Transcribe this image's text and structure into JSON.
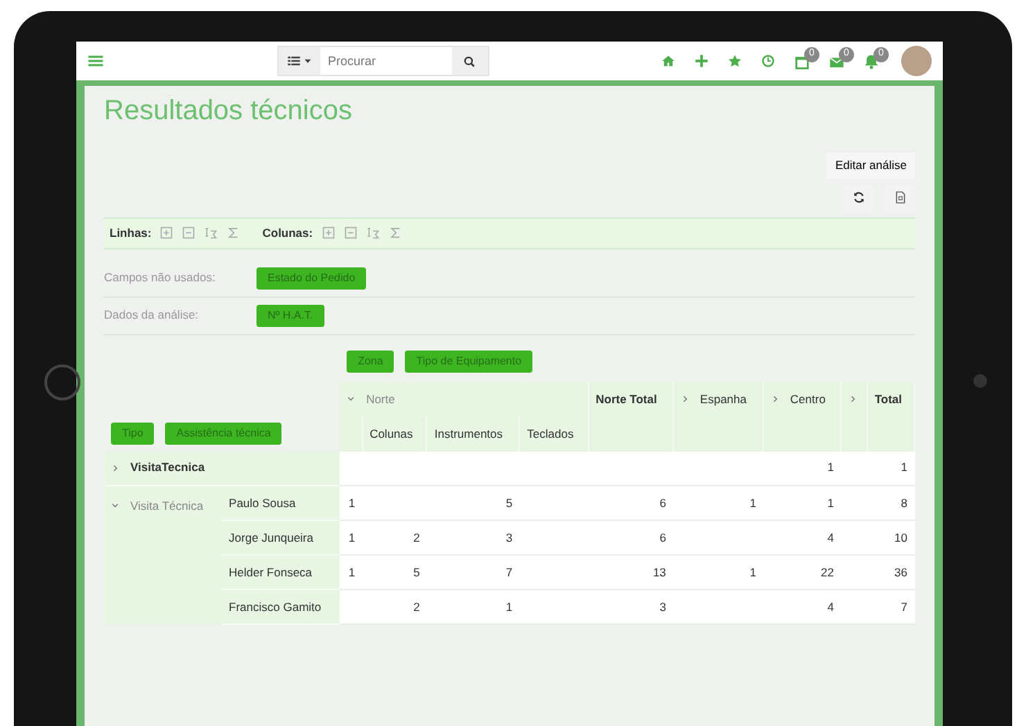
{
  "navbar": {
    "search": {
      "placeholder": "Procurar"
    },
    "notifications": [
      {
        "badge": "0"
      },
      {
        "badge": "0"
      },
      {
        "badge": "0"
      }
    ]
  },
  "page": {
    "title": "Resultados técnicos",
    "edit_button": "Editar análise"
  },
  "toolbar": [
    {
      "label": "Linhas:"
    },
    {
      "label": "Colunas:"
    }
  ],
  "fields": [
    {
      "label": "Campos não usados:",
      "chips": [
        "Estado do Pedido"
      ]
    },
    {
      "label": "Dados da análise:",
      "chips": [
        "Nº H.A.T."
      ]
    }
  ],
  "column_chips": [
    "Zona",
    "Tipo de Equipamento"
  ],
  "row_chips": [
    "Tipo",
    "Assistência técnica"
  ],
  "pivot": {
    "columns": [
      {
        "kind": "group",
        "label": "Norte",
        "expanded": true,
        "children": [
          {
            "kind": "blank"
          },
          {
            "label": "Colunas"
          },
          {
            "label": "Instrumentos"
          },
          {
            "label": "Teclados"
          }
        ]
      },
      {
        "kind": "total",
        "label": "Norte Total"
      },
      {
        "kind": "group",
        "label": "Espanha",
        "expanded": false
      },
      {
        "kind": "group",
        "label": "Centro",
        "expanded": false
      },
      {
        "kind": "group",
        "expanded": false
      },
      {
        "kind": "total",
        "label": "Total"
      }
    ],
    "rows": [
      {
        "label": "VisitaTecnica",
        "expanded": false,
        "values": {
          "col_7": "1",
          "col_9": "1"
        }
      },
      {
        "label": "Visita Técnica",
        "expanded": true,
        "children": [
          {
            "label": "Paulo Sousa",
            "values": {
              "col_1": "1",
              "col_3": "5",
              "col_5": "6",
              "col_6": "1",
              "col_7": "1",
              "col_9": "8"
            }
          },
          {
            "label": "Jorge Junqueira",
            "values": {
              "col_1": "1",
              "col_2": "2",
              "col_3": "3",
              "col_5": "6",
              "col_7": "4",
              "col_9": "10"
            }
          },
          {
            "label": "Helder Fonseca",
            "values": {
              "col_1": "1",
              "col_2": "5",
              "col_3": "7",
              "col_5": "13",
              "col_6": "1",
              "col_7": "22",
              "col_9": "36"
            }
          },
          {
            "label": "Francisco Gamito",
            "values": {
              "col_2": "2",
              "col_3": "1",
              "col_5": "3",
              "col_7": "4",
              "col_9": "7"
            }
          }
        ]
      }
    ]
  }
}
